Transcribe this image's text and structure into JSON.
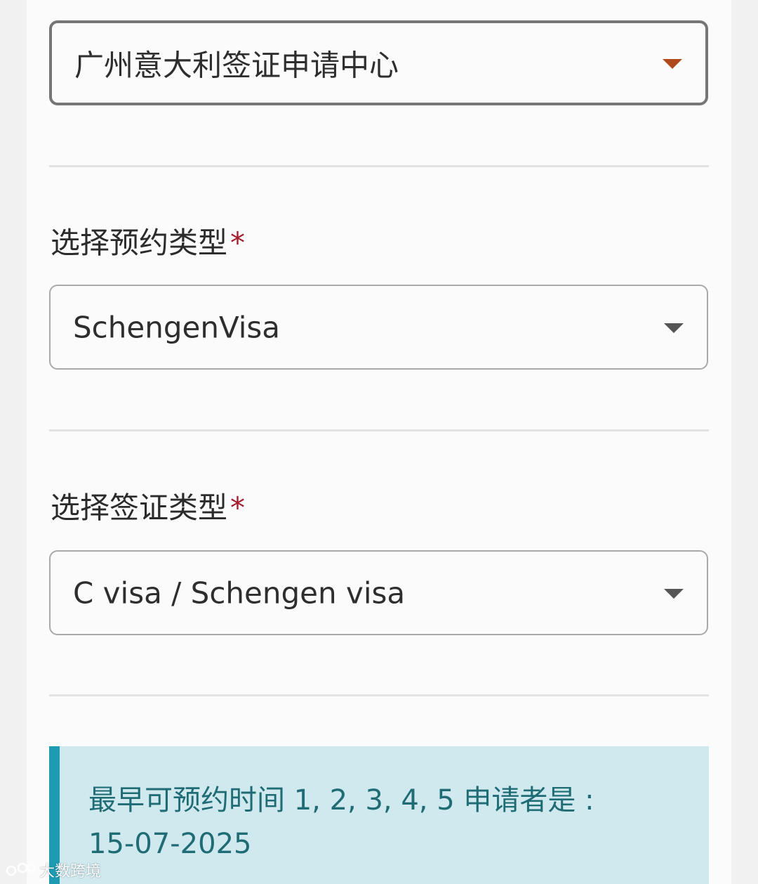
{
  "center_select": {
    "value": "广州意大利签证申请中心",
    "caret_icon": "caret-down-icon",
    "caret_color": "#b04a1c"
  },
  "appointment_type": {
    "label": "选择预约类型",
    "required_mark": "*",
    "value": "SchengenVisa",
    "caret_icon": "caret-down-icon"
  },
  "visa_type": {
    "label": "选择签证类型",
    "required_mark": "*",
    "value": "C visa / Schengen visa",
    "caret_icon": "caret-down-icon"
  },
  "notice": {
    "line1": "最早可预约时间 1, 2, 3, 4, 5 申请者是 :",
    "line2": "15-07-2025"
  },
  "watermark": {
    "text": "大数跨境"
  },
  "colors": {
    "accent_bar": "#1d9bb3",
    "notice_bg": "#cfe9ee",
    "notice_text": "#1f6c75",
    "required": "#a31d2d"
  }
}
